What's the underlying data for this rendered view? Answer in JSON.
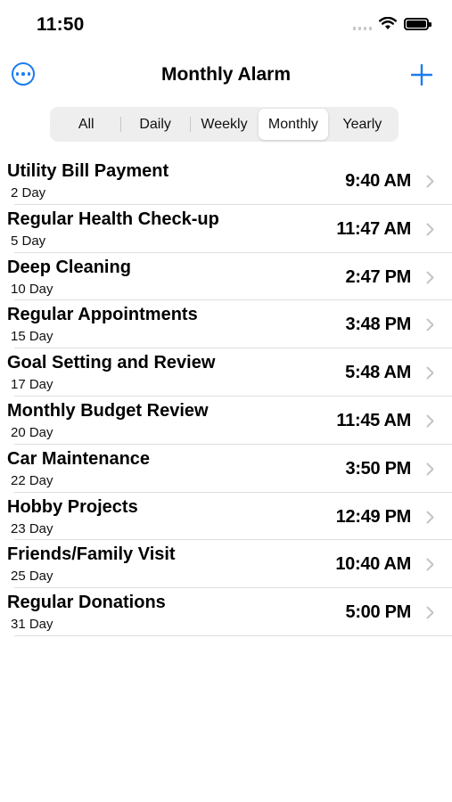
{
  "status_bar": {
    "time": "11:50"
  },
  "nav": {
    "title": "Monthly Alarm",
    "more_icon": "ellipsis-circle-icon",
    "add_icon": "plus-icon"
  },
  "segments": [
    {
      "label": "All"
    },
    {
      "label": "Daily"
    },
    {
      "label": "Weekly"
    },
    {
      "label": "Monthly"
    },
    {
      "label": "Yearly"
    }
  ],
  "selected_segment": "Monthly",
  "alarms": [
    {
      "title": "Utility Bill Payment",
      "day": "2 Day",
      "time": "9:40 AM"
    },
    {
      "title": "Regular Health Check-up",
      "day": "5 Day",
      "time": "11:47 AM"
    },
    {
      "title": "Deep Cleaning",
      "day": "10 Day",
      "time": "2:47 PM"
    },
    {
      "title": "Regular Appointments",
      "day": "15 Day",
      "time": "3:48 PM"
    },
    {
      "title": "Goal Setting and Review",
      "day": "17 Day",
      "time": "5:48 AM"
    },
    {
      "title": "Monthly Budget Review",
      "day": "20 Day",
      "time": "11:45 AM"
    },
    {
      "title": "Car Maintenance",
      "day": "22 Day",
      "time": "3:50 PM"
    },
    {
      "title": "Hobby Projects",
      "day": "23 Day",
      "time": "12:49 PM"
    },
    {
      "title": "Friends/Family Visit",
      "day": "25 Day",
      "time": "10:40 AM"
    },
    {
      "title": "Regular Donations",
      "day": "31 Day",
      "time": "5:00 PM"
    }
  ],
  "colors": {
    "accent": "#1b7cf2",
    "divider": "#dedee0",
    "segment_bg": "#eeeeef"
  }
}
